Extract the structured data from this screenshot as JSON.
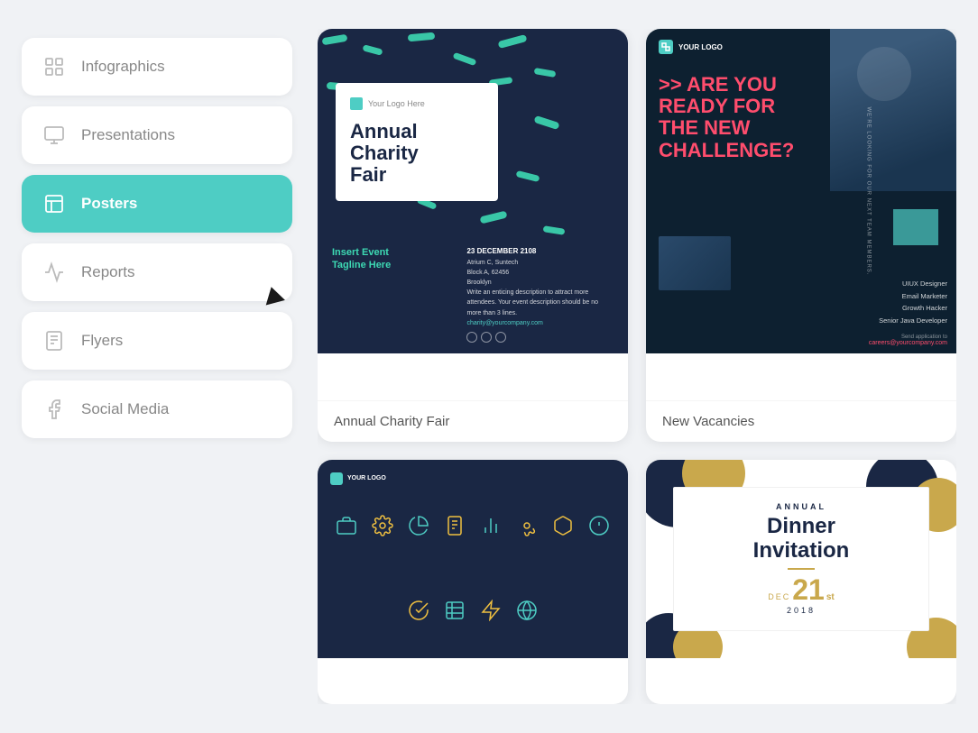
{
  "sidebar": {
    "items": [
      {
        "id": "infographics",
        "label": "Infographics",
        "active": false
      },
      {
        "id": "presentations",
        "label": "Presentations",
        "active": false
      },
      {
        "id": "posters",
        "label": "Posters",
        "active": true
      },
      {
        "id": "reports",
        "label": "Reports",
        "active": false
      },
      {
        "id": "flyers",
        "label": "Flyers",
        "active": false
      },
      {
        "id": "social-media",
        "label": "Social Media",
        "active": false
      }
    ]
  },
  "cards": [
    {
      "id": "annual-charity-fair",
      "label": "Annual Charity Fair",
      "type": "charity"
    },
    {
      "id": "new-vacancies",
      "label": "New Vacancies",
      "type": "vacancies"
    },
    {
      "id": "poster3",
      "label": "",
      "type": "poster3"
    },
    {
      "id": "dinner-invitation",
      "label": "",
      "type": "dinner"
    }
  ],
  "charity": {
    "logo_text": "Your Logo Here",
    "title_line1": "Annual",
    "title_line2": "Charity",
    "title_line3": "Fair",
    "tagline": "Insert Event\nTagline Here",
    "date": "23 DECEMBER 2108",
    "venue_line1": "Atrium C, Suntech",
    "venue_line2": "Block A, 62456",
    "venue_line3": "Brooklyn",
    "description": "Write an enticing description to attract more attendees. Your event description should be no more than 3 lines.",
    "email": "charity@yourcompany.com"
  },
  "vacancies": {
    "logo_text": "YOUR LOGO",
    "heading_line1": ">> ARE YOU",
    "heading_line2": "READY FOR",
    "heading_line3": "THE NEW",
    "heading_line4": "CHALLENGE?",
    "side_text": "WE'RE LOOKING FOR OUR NEXT TEAM MEMBERS.",
    "jobs": [
      "UIUX Designer",
      "Email Marketer",
      "Growth Hacker",
      "Senior Java Developer"
    ],
    "send_label": "Send application to",
    "email": "careers@yourcompany.com"
  },
  "poster3": {
    "logo_text": "YOUR LOGO"
  },
  "dinner": {
    "annual_label": "ANNUAL",
    "title_line1": "Dinner",
    "title_line2": "Invitation",
    "dec_label": "DEC",
    "day": "21",
    "superscript": "st",
    "year": "2018"
  }
}
